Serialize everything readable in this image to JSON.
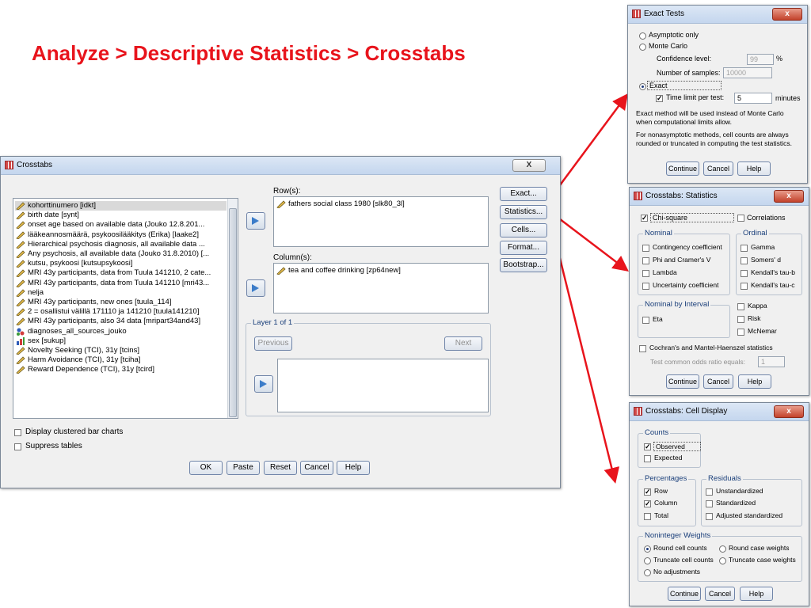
{
  "headline": "Analyze > Descriptive Statistics > Crosstabs",
  "colors": {
    "headline": "#e8141c",
    "arrow": "#e8141c"
  },
  "crosstabs": {
    "title": "Crosstabs",
    "close": "X",
    "variables": [
      {
        "label": "kohorttinumero [idkt]",
        "icon": "ruler-pencil-icon"
      },
      {
        "label": "birth date [synt]",
        "icon": "ruler-pencil-icon"
      },
      {
        "label": "onset age based on available data (Jouko 12.8.201...",
        "icon": "ruler-pencil-icon"
      },
      {
        "label": "lääkeannosmäärä, psykoosilääkitys (Erika) [laake2]",
        "icon": "ruler-pencil-icon"
      },
      {
        "label": "Hierarchical psychosis diagnosis, all available data ...",
        "icon": "ruler-pencil-icon"
      },
      {
        "label": "Any psychosis, all available data (Jouko 31.8.2010) [...",
        "icon": "ruler-pencil-icon"
      },
      {
        "label": "kutsu, psykoosi [kutsupsykoosi]",
        "icon": "ruler-pencil-icon"
      },
      {
        "label": "MRI 43y participants, data from Tuula 141210, 2 cate...",
        "icon": "ruler-pencil-icon"
      },
      {
        "label": "MRI 43y participants, data from Tuula 141210 [mri43...",
        "icon": "ruler-pencil-icon"
      },
      {
        "label": "nelja",
        "icon": "ruler-pencil-icon"
      },
      {
        "label": "MRI 43y participants, new ones [tuula_114]",
        "icon": "ruler-pencil-icon"
      },
      {
        "label": "2 = osallistui välillä 171110 ja 141210 [tuula141210]",
        "icon": "ruler-pencil-icon"
      },
      {
        "label": "MRI 43y participants, also 34 data [mripart34and43]",
        "icon": "ruler-pencil-icon"
      },
      {
        "label": "diagnoses_all_sources_jouko",
        "icon": "nominal-icon"
      },
      {
        "label": "sex [sukup]",
        "icon": "bar-chart-icon"
      },
      {
        "label": "Novelty Seeking (TCI), 31y [tcins]",
        "icon": "ruler-pencil-icon"
      },
      {
        "label": "Harm Avoidance (TCI), 31y [tciha]",
        "icon": "ruler-pencil-icon"
      },
      {
        "label": "Reward Dependence (TCI), 31y [tcird]",
        "icon": "ruler-pencil-icon"
      }
    ],
    "rows_label": "Row(s):",
    "rows_item": "fathers social class 1980 [slk80_3l]",
    "columns_label": "Column(s):",
    "columns_item": "tea and coffee drinking [zp64new]",
    "layer_label": "Layer 1 of 1",
    "previous": "Previous",
    "next": "Next",
    "side_buttons": [
      "Exact...",
      "Statistics...",
      "Cells...",
      "Format...",
      "Bootstrap..."
    ],
    "display_clustered": "Display clustered bar charts",
    "suppress_tables": "Suppress tables",
    "bottom_buttons": [
      "OK",
      "Paste",
      "Reset",
      "Cancel",
      "Help"
    ]
  },
  "exact": {
    "title": "Exact Tests",
    "asymptotic": "Asymptotic only",
    "monte_carlo": "Monte Carlo",
    "confidence_label": "Confidence level:",
    "confidence_value": "99",
    "percent": "%",
    "samples_label": "Number of samples:",
    "samples_value": "10000",
    "exact_label": "Exact",
    "time_limit_label": "Time limit per test:",
    "time_limit_value": "5",
    "minutes": "minutes",
    "note1": "Exact method will be used instead of Monte Carlo when computational limits allow.",
    "note2": "For nonasymptotic methods, cell counts are always rounded or truncated in computing the test statistics.",
    "buttons": [
      "Continue",
      "Cancel",
      "Help"
    ]
  },
  "stats": {
    "title": "Crosstabs: Statistics",
    "chi_square": "Chi-square",
    "correlations": "Correlations",
    "nominal": "Nominal",
    "nominal_items": [
      "Contingency coefficient",
      "Phi and Cramer's V",
      "Lambda",
      "Uncertainty coefficient"
    ],
    "ordinal": "Ordinal",
    "ordinal_items": [
      "Gamma",
      "Somers' d",
      "Kendall's tau-b",
      "Kendall's tau-c"
    ],
    "nominal_interval": "Nominal by Interval",
    "eta": "Eta",
    "kappa": "Kappa",
    "risk": "Risk",
    "mcnemar": "McNemar",
    "cochran": "Cochran's and Mantel-Haenszel statistics",
    "odds_label": "Test common odds ratio equals:",
    "odds_value": "1",
    "buttons": [
      "Continue",
      "Cancel",
      "Help"
    ]
  },
  "cells": {
    "title": "Crosstabs: Cell Display",
    "counts": "Counts",
    "observed": "Observed",
    "expected": "Expected",
    "percentages": "Percentages",
    "row": "Row",
    "column": "Column",
    "total": "Total",
    "residuals": "Residuals",
    "unstandardized": "Unstandardized",
    "standardized": "Standardized",
    "adjusted": "Adjusted standardized",
    "noninteger": "Noninteger Weights",
    "round_cell": "Round cell counts",
    "round_case": "Round case weights",
    "truncate_cell": "Truncate cell counts",
    "truncate_case": "Truncate case weights",
    "no_adjust": "No adjustments",
    "buttons": [
      "Continue",
      "Cancel",
      "Help"
    ]
  }
}
